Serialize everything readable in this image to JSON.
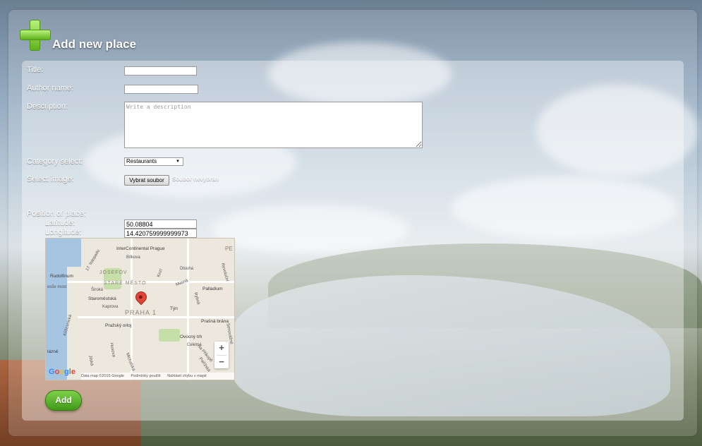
{
  "header": {
    "title": "Add new place"
  },
  "form": {
    "title_label": "Title:",
    "title_value": "",
    "author_label": "Author name:",
    "author_value": "",
    "description_label": "Description:",
    "description_placeholder": "Write a description",
    "category_label": "Category select:",
    "category_selected": "Restaurants",
    "image_label": "Select image:",
    "file_button_label": "Vybrat soubor",
    "file_status": "Soubor nevybrán",
    "position_label": "Position of place:",
    "latitude_label": "Latitude:",
    "latitude_value": "50.08804",
    "longitude_label": "Longitude:",
    "longitude_value": "14.420759999999973",
    "submit_label": "Add"
  },
  "map": {
    "district": "PRAHA 1",
    "old_town": "STARÉ MĚSTO",
    "josefov": "JOSEFOV",
    "pois": {
      "intercontinental": "InterContinental Prague",
      "rudolfinum": "Rudolfinum",
      "staromestska": "Staroměstská",
      "palladium": "Palladium",
      "orloj": "Pražský orloj",
      "prasna_brana": "Prašná brána",
      "tyn": "Týn",
      "lazne": "lázně",
      "ovocny_trh": "Ovocný trh"
    },
    "streets": {
      "listopadu": "17. listopadu",
      "bilkova": "Bílkova",
      "dlouha": "Dlouhá",
      "masna": "Masná",
      "kozi": "Kozí",
      "siroka": "Široká",
      "kaprova": "Kaprova",
      "krizovnicka": "Křižovnická",
      "husova": "Husova",
      "jilska": "Jilská",
      "michalska": "Michalská",
      "na_prikope": "Na Příkopě",
      "rybna": "Rybná",
      "revolucni": "Revoluční",
      "celetna": "Celetná",
      "parizska": "Pařížská",
      "hybernska": "Hybernská",
      "smetanovo": "Smetanovo nábř.",
      "dvorakovo": "esův most",
      "senovazne": "Senovážné",
      "petrska": "PE"
    },
    "zoom_in": "+",
    "zoom_out": "−",
    "footer": [
      "Data map ©2015 Google",
      "Podmínky použití",
      "Nahlásit chybu v mapě"
    ],
    "logo": [
      "G",
      "o",
      "o",
      "g",
      "l",
      "e"
    ]
  }
}
